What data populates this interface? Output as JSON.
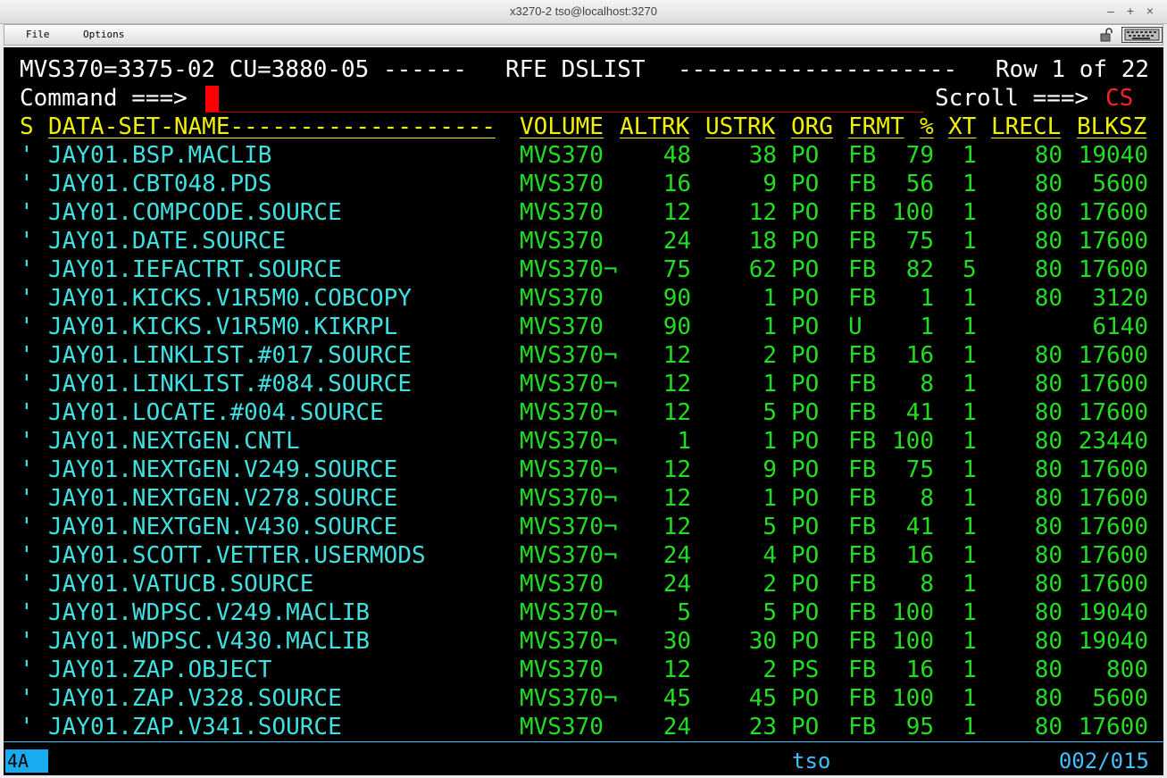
{
  "window": {
    "title": "x3270-2 tso@localhost:3270"
  },
  "menu": {
    "file": "File",
    "options": "Options"
  },
  "screen": {
    "header_left": "MVS370=3375-02 CU=3880-05 ------",
    "header_title": "RFE DSLIST",
    "header_dashes": "--------------------",
    "header_right": "Row 1 of 22",
    "command_label": "Command ===>",
    "command_value": "",
    "scroll_label": "Scroll ===>",
    "scroll_value": "CS"
  },
  "columns": {
    "s": "S",
    "dsn": "DATA-SET-NAME-------------------",
    "volume": "VOLUME",
    "altrk": "ALTRK",
    "ustrk": "USTRK",
    "org": "ORG",
    "frmt": "FRMT",
    "pct": "%",
    "xt": "XT",
    "lrecl": "LRECL",
    "blksz": "BLKSZ"
  },
  "datasets": [
    {
      "s": "'",
      "dsn": "JAY01.BSP.MACLIB",
      "volume": "MVS370",
      "altrk": "48",
      "ustrk": "38",
      "org": "PO",
      "frmt": "FB",
      "pct": "79",
      "xt": "1",
      "lrecl": "80",
      "blksz": "19040"
    },
    {
      "s": "'",
      "dsn": "JAY01.CBT048.PDS",
      "volume": "MVS370",
      "altrk": "16",
      "ustrk": "9",
      "org": "PO",
      "frmt": "FB",
      "pct": "56",
      "xt": "1",
      "lrecl": "80",
      "blksz": "5600"
    },
    {
      "s": "'",
      "dsn": "JAY01.COMPCODE.SOURCE",
      "volume": "MVS370",
      "altrk": "12",
      "ustrk": "12",
      "org": "PO",
      "frmt": "FB",
      "pct": "100",
      "xt": "1",
      "lrecl": "80",
      "blksz": "17600"
    },
    {
      "s": "'",
      "dsn": "JAY01.DATE.SOURCE",
      "volume": "MVS370",
      "altrk": "24",
      "ustrk": "18",
      "org": "PO",
      "frmt": "FB",
      "pct": "75",
      "xt": "1",
      "lrecl": "80",
      "blksz": "17600"
    },
    {
      "s": "'",
      "dsn": "JAY01.IEFACTRT.SOURCE",
      "volume": "MVS370¬",
      "altrk": "75",
      "ustrk": "62",
      "org": "PO",
      "frmt": "FB",
      "pct": "82",
      "xt": "5",
      "lrecl": "80",
      "blksz": "17600"
    },
    {
      "s": "'",
      "dsn": "JAY01.KICKS.V1R5M0.COBCOPY",
      "volume": "MVS370",
      "altrk": "90",
      "ustrk": "1",
      "org": "PO",
      "frmt": "FB",
      "pct": "1",
      "xt": "1",
      "lrecl": "80",
      "blksz": "3120"
    },
    {
      "s": "'",
      "dsn": "JAY01.KICKS.V1R5M0.KIKRPL",
      "volume": "MVS370",
      "altrk": "90",
      "ustrk": "1",
      "org": "PO",
      "frmt": "U",
      "pct": "1",
      "xt": "1",
      "lrecl": "",
      "blksz": "6140"
    },
    {
      "s": "'",
      "dsn": "JAY01.LINKLIST.#017.SOURCE",
      "volume": "MVS370¬",
      "altrk": "12",
      "ustrk": "2",
      "org": "PO",
      "frmt": "FB",
      "pct": "16",
      "xt": "1",
      "lrecl": "80",
      "blksz": "17600"
    },
    {
      "s": "'",
      "dsn": "JAY01.LINKLIST.#084.SOURCE",
      "volume": "MVS370¬",
      "altrk": "12",
      "ustrk": "1",
      "org": "PO",
      "frmt": "FB",
      "pct": "8",
      "xt": "1",
      "lrecl": "80",
      "blksz": "17600"
    },
    {
      "s": "'",
      "dsn": "JAY01.LOCATE.#004.SOURCE",
      "volume": "MVS370¬",
      "altrk": "12",
      "ustrk": "5",
      "org": "PO",
      "frmt": "FB",
      "pct": "41",
      "xt": "1",
      "lrecl": "80",
      "blksz": "17600"
    },
    {
      "s": "'",
      "dsn": "JAY01.NEXTGEN.CNTL",
      "volume": "MVS370¬",
      "altrk": "1",
      "ustrk": "1",
      "org": "PO",
      "frmt": "FB",
      "pct": "100",
      "xt": "1",
      "lrecl": "80",
      "blksz": "23440"
    },
    {
      "s": "'",
      "dsn": "JAY01.NEXTGEN.V249.SOURCE",
      "volume": "MVS370¬",
      "altrk": "12",
      "ustrk": "9",
      "org": "PO",
      "frmt": "FB",
      "pct": "75",
      "xt": "1",
      "lrecl": "80",
      "blksz": "17600"
    },
    {
      "s": "'",
      "dsn": "JAY01.NEXTGEN.V278.SOURCE",
      "volume": "MVS370¬",
      "altrk": "12",
      "ustrk": "1",
      "org": "PO",
      "frmt": "FB",
      "pct": "8",
      "xt": "1",
      "lrecl": "80",
      "blksz": "17600"
    },
    {
      "s": "'",
      "dsn": "JAY01.NEXTGEN.V430.SOURCE",
      "volume": "MVS370¬",
      "altrk": "12",
      "ustrk": "5",
      "org": "PO",
      "frmt": "FB",
      "pct": "41",
      "xt": "1",
      "lrecl": "80",
      "blksz": "17600"
    },
    {
      "s": "'",
      "dsn": "JAY01.SCOTT.VETTER.USERMODS",
      "volume": "MVS370¬",
      "altrk": "24",
      "ustrk": "4",
      "org": "PO",
      "frmt": "FB",
      "pct": "16",
      "xt": "1",
      "lrecl": "80",
      "blksz": "17600"
    },
    {
      "s": "'",
      "dsn": "JAY01.VATUCB.SOURCE",
      "volume": "MVS370",
      "altrk": "24",
      "ustrk": "2",
      "org": "PO",
      "frmt": "FB",
      "pct": "8",
      "xt": "1",
      "lrecl": "80",
      "blksz": "17600"
    },
    {
      "s": "'",
      "dsn": "JAY01.WDPSC.V249.MACLIB",
      "volume": "MVS370¬",
      "altrk": "5",
      "ustrk": "5",
      "org": "PO",
      "frmt": "FB",
      "pct": "100",
      "xt": "1",
      "lrecl": "80",
      "blksz": "19040"
    },
    {
      "s": "'",
      "dsn": "JAY01.WDPSC.V430.MACLIB",
      "volume": "MVS370¬",
      "altrk": "30",
      "ustrk": "30",
      "org": "PO",
      "frmt": "FB",
      "pct": "100",
      "xt": "1",
      "lrecl": "80",
      "blksz": "19040"
    },
    {
      "s": "'",
      "dsn": "JAY01.ZAP.OBJECT",
      "volume": "MVS370",
      "altrk": "12",
      "ustrk": "2",
      "org": "PS",
      "frmt": "FB",
      "pct": "16",
      "xt": "1",
      "lrecl": "80",
      "blksz": "800"
    },
    {
      "s": "'",
      "dsn": "JAY01.ZAP.V328.SOURCE",
      "volume": "MVS370¬",
      "altrk": "45",
      "ustrk": "45",
      "org": "PO",
      "frmt": "FB",
      "pct": "100",
      "xt": "1",
      "lrecl": "80",
      "blksz": "5600"
    },
    {
      "s": "'",
      "dsn": "JAY01.ZAP.V341.SOURCE",
      "volume": "MVS370",
      "altrk": "24",
      "ustrk": "23",
      "org": "PO",
      "frmt": "FB",
      "pct": "95",
      "xt": "1",
      "lrecl": "80",
      "blksz": "17600"
    }
  ],
  "oia": {
    "keyboard": "4A",
    "host": "tso",
    "cursor_pos": "002/015"
  },
  "colors": {
    "screen_bg": "#000000",
    "field_cyan": "#40e0e0",
    "field_green": "#22dd22",
    "header_yellow": "#f0f000",
    "scroll_red": "#ff2020",
    "oia_blue": "#40c0ff"
  },
  "icons": {
    "lock": "lock-icon",
    "keyboard": "keyboard-icon"
  }
}
